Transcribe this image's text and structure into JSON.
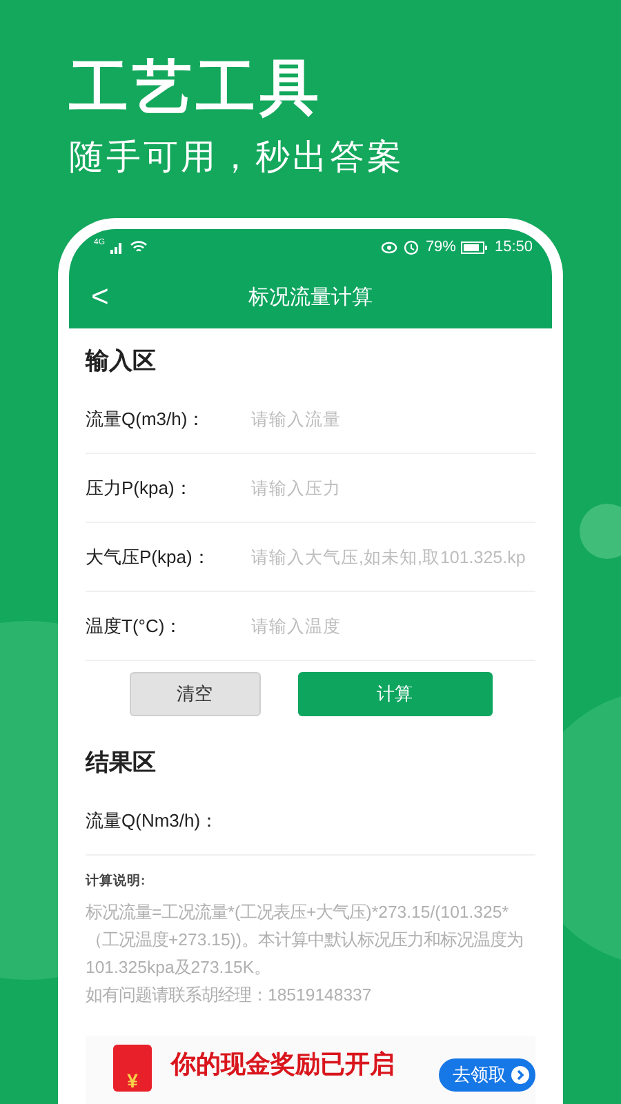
{
  "promo": {
    "title": "工艺工具",
    "subtitle": "随手可用，秒出答案"
  },
  "status_bar": {
    "network": "4G",
    "battery_text": "79%",
    "time": "15:50"
  },
  "header": {
    "back": "<",
    "title": "标况流量计算"
  },
  "input_section": {
    "title": "输入区",
    "fields": [
      {
        "label": "流量Q(m3/h)：",
        "placeholder": "请输入流量"
      },
      {
        "label": "压力P(kpa)：",
        "placeholder": "请输入压力"
      },
      {
        "label": "大气压P(kpa)：",
        "placeholder": "请输入大气压,如未知,取101.325.kp"
      },
      {
        "label": "温度T(°C)：",
        "placeholder": "请输入温度"
      }
    ]
  },
  "buttons": [
    {
      "label": "清空",
      "kind": "secondary"
    },
    {
      "label": "计算",
      "kind": "primary"
    }
  ],
  "result_section": {
    "title": "结果区",
    "rows": [
      {
        "label": "流量Q(Nm3/h)："
      }
    ]
  },
  "notes": {
    "title": "计算说明:",
    "text": "标况流量=工况流量*(工况表压+大气压)*273.15/(101.325* （工况温度+273.15))。本计算中默认标况压力和标况温度为 101.325kpa及273.15K。",
    "contact": "如有问题请联系胡经理：18519148337"
  },
  "ad": {
    "envelope_mark": "¥",
    "text": "你的现金奖励已开启",
    "button": "去领取"
  }
}
